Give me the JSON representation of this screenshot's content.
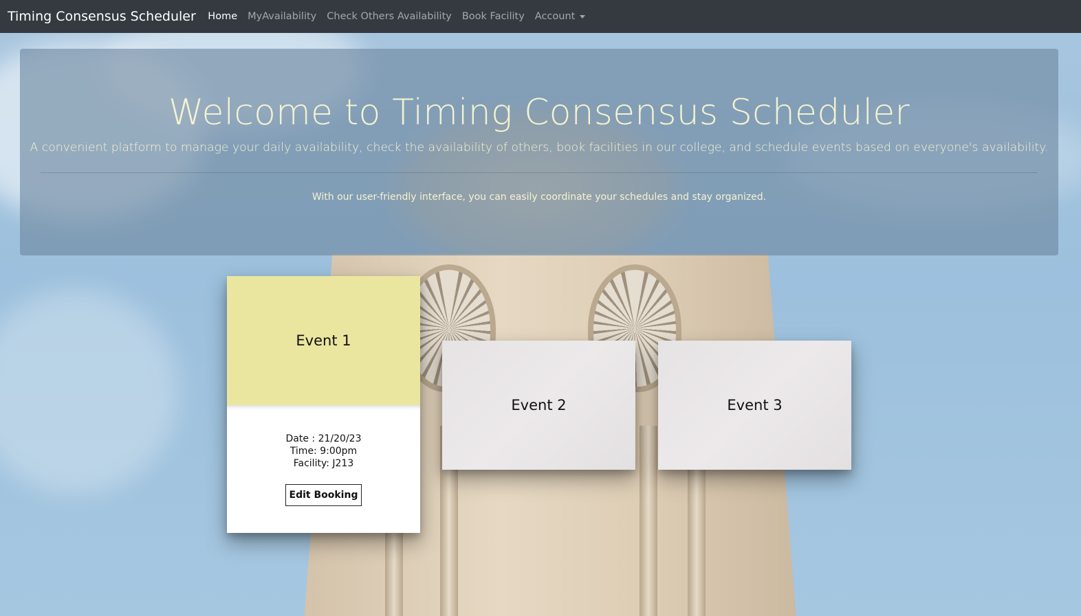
{
  "navbar": {
    "brand": "Timing Consensus Scheduler",
    "links": [
      {
        "label": "Home",
        "active": true
      },
      {
        "label": "MyAvailability",
        "active": false
      },
      {
        "label": "Check Others Availability",
        "active": false
      },
      {
        "label": "Book Facility",
        "active": false
      },
      {
        "label": "Account",
        "active": false,
        "dropdown": true
      }
    ],
    "background_color": "#343a40"
  },
  "jumbotron": {
    "title": "Welcome to Timing Consensus Scheduler",
    "lead": "A convenient platform to manage your daily availability, check the availability of others, book facilities in our college, and schedule events based on everyone's availability.",
    "text": "With our user-friendly interface, you can easily coordinate your schedules and stay organized.",
    "text_color": "#f5f3d0"
  },
  "events": [
    {
      "title": "Event 1",
      "selected": true,
      "date_line": "Date : 21/20/23",
      "time_line": "Time: 9:00pm",
      "facility_line": "Facility: J213",
      "button_label": "Edit Booking",
      "accent_color": "#ebe69f"
    },
    {
      "title": "Event 2",
      "selected": false
    },
    {
      "title": "Event 3",
      "selected": false
    }
  ],
  "icons": {
    "account_dropdown": "caret-down-icon"
  }
}
